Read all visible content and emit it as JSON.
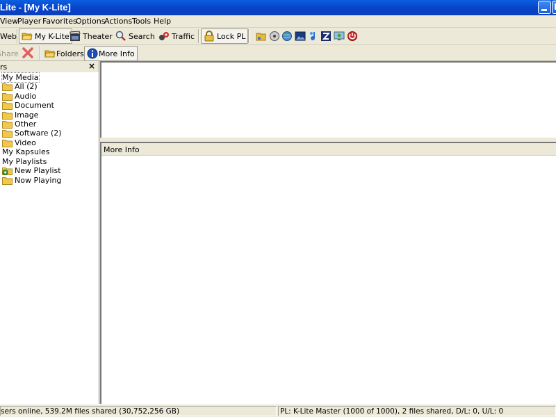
{
  "window": {
    "title": "Lite - [My K-Lite]"
  },
  "menu": [
    "View",
    "Player",
    "Favorites",
    "Options",
    "Actions",
    "Tools",
    "Help"
  ],
  "toolbar": {
    "web": "Web",
    "my_klite": "My K-Lite",
    "theater": "Theater",
    "search": "Search",
    "traffic": "Traffic",
    "lock_pl": "Lock PL",
    "share": "Share",
    "folders": "Folders",
    "more_info": "More Info"
  },
  "left_pane": {
    "header": "rs",
    "close": "×",
    "tree": {
      "my_media": "My Media",
      "all": "All (2)",
      "audio": "Audio",
      "document": "Document",
      "image": "Image",
      "other": "Other",
      "software": "Software (2)",
      "video": "Video",
      "my_kapsules": "My Kapsules",
      "my_playlists": "My Playlists",
      "new_playlist": "New Playlist",
      "now_playing": "Now Playing"
    }
  },
  "info_pane": {
    "header": "More Info"
  },
  "status": {
    "left": "sers online, 539.2M files shared (30,752,256 GB)",
    "right": "PL: K-Lite Master (1000 of 1000), 2 files shared, D/L: 0, U/L: 0"
  },
  "colors": {
    "titlebar": "#0842c8",
    "chrome": "#ece9d8",
    "folder": "#f2c84b"
  }
}
